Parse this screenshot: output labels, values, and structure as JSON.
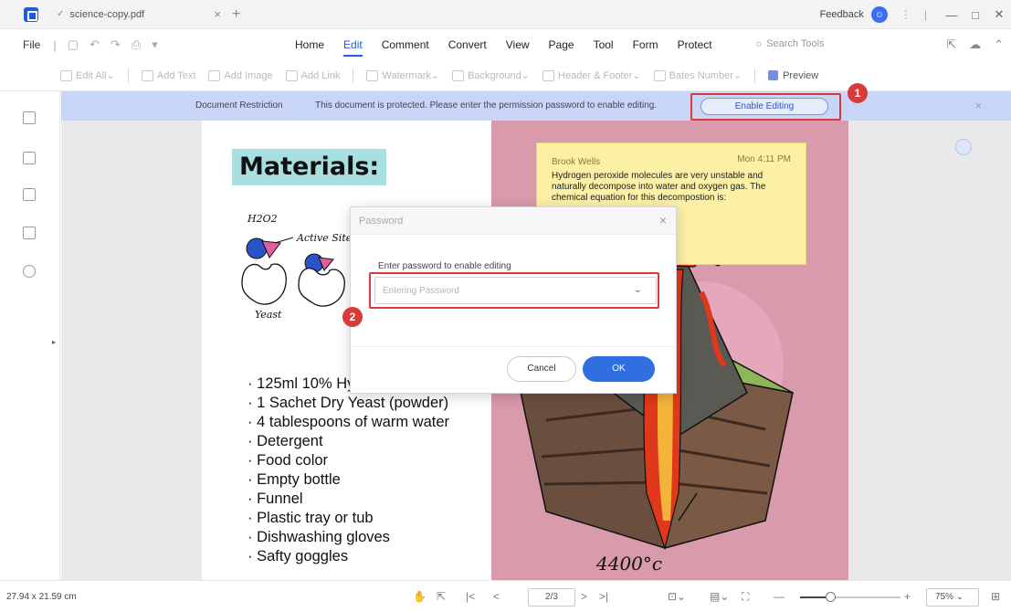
{
  "titlebar": {
    "tab_title": "science-copy.pdf",
    "feedback": "Feedback"
  },
  "menubar": {
    "file": "File",
    "menus": [
      "Home",
      "Edit",
      "Comment",
      "Convert",
      "View",
      "Page",
      "Tool",
      "Form",
      "Protect"
    ],
    "active_menu": "Edit",
    "search_tools": "Search Tools"
  },
  "toolbar": {
    "tools": [
      "Edit All",
      "Add Text",
      "Add Image",
      "Add Link",
      "Watermark",
      "Background",
      "Header & Footer",
      "Bates Number"
    ],
    "preview": "Preview"
  },
  "restriction": {
    "label": "Document Restriction",
    "message": "This document is protected. Please enter the permission password to enable editing.",
    "enable_button": "Enable Editing"
  },
  "annotations": {
    "step1": "1",
    "step2": "2"
  },
  "document": {
    "materials_title": "Materials:",
    "sketch_labels": {
      "h2o2": "H2O2",
      "active_site": "Active Site",
      "yeast": "Yeast"
    },
    "materials_list": [
      "125ml 10% Hy",
      "1 Sachet Dry Yeast (powder)",
      "4 tablespoons of warm water",
      "Detergent",
      "Food color",
      "Empty bottle",
      "Funnel",
      "Plastic tray or tub",
      "Dishwashing gloves",
      "Safty goggles"
    ],
    "note": {
      "author": "Brook Wells",
      "time": "Mon 4:11 PM",
      "body": "Hydrogen peroxide molecules are very unstable and naturally decompose into water and oxygen gas. The chemical equation for this decompostion is:"
    },
    "temperature_label": "4400°c"
  },
  "dialog": {
    "title": "Password",
    "prompt": "Enter password to enable editing",
    "input_placeholder": "Entering Password",
    "cancel": "Cancel",
    "ok": "OK"
  },
  "statusbar": {
    "page_size": "27.94 x 21.59 cm",
    "page_indicator": "2/3",
    "zoom": "75%",
    "zoom_slider_fraction": 0.3
  },
  "colors": {
    "accent": "#1f5cd6",
    "restriction_bar": "#c9d5f7",
    "annotation_red": "#d93a3a",
    "ok_button": "#2f6fe0",
    "page_pink": "#d99aab",
    "note_yellow": "#fbf0a4",
    "title_highlight": "#a8dfe0"
  }
}
